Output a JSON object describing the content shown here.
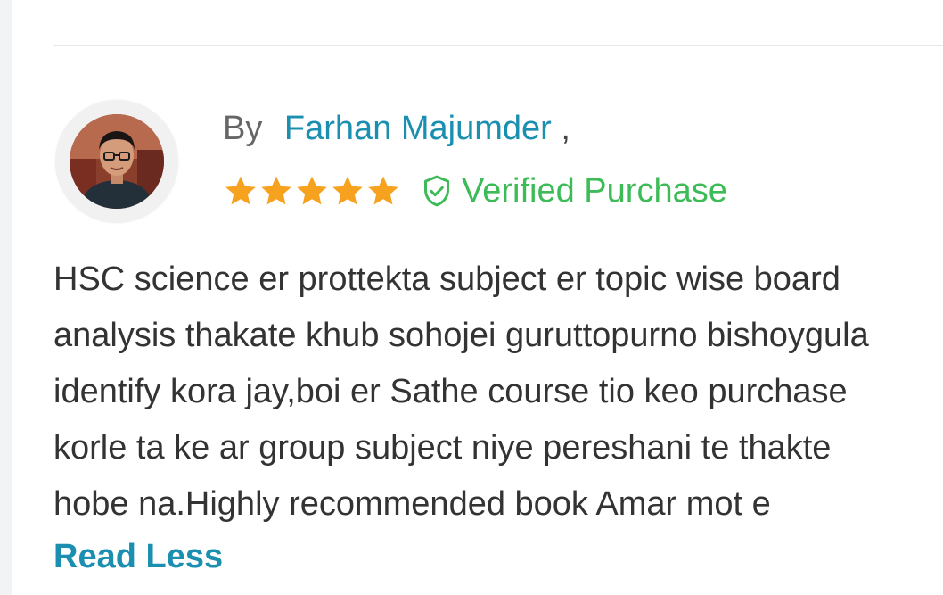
{
  "review": {
    "by_label": "By",
    "author": "Farhan Majumder",
    "author_suffix": ",",
    "rating": 5,
    "rating_max": 5,
    "verified_label": "Verified Purchase",
    "text_lines": [
      "HSC science er prottekta subject er topic wise board",
      "analysis thakate khub sohojei guruttopurno bishoygula",
      "identify kora jay,boi er Sathe course tio keo purchase",
      "korle ta ke ar group subject niye pereshani te thakte",
      "hobe na.Highly recommended book Amar mot e"
    ],
    "toggle_label": "Read Less"
  },
  "colors": {
    "accent": "#1b8fb0",
    "star": "#f6a21e",
    "verified": "#3dbb57",
    "text": "#333333"
  },
  "icons": {
    "star": "star-icon",
    "verified": "shield-check-icon",
    "avatar": "user-avatar"
  }
}
